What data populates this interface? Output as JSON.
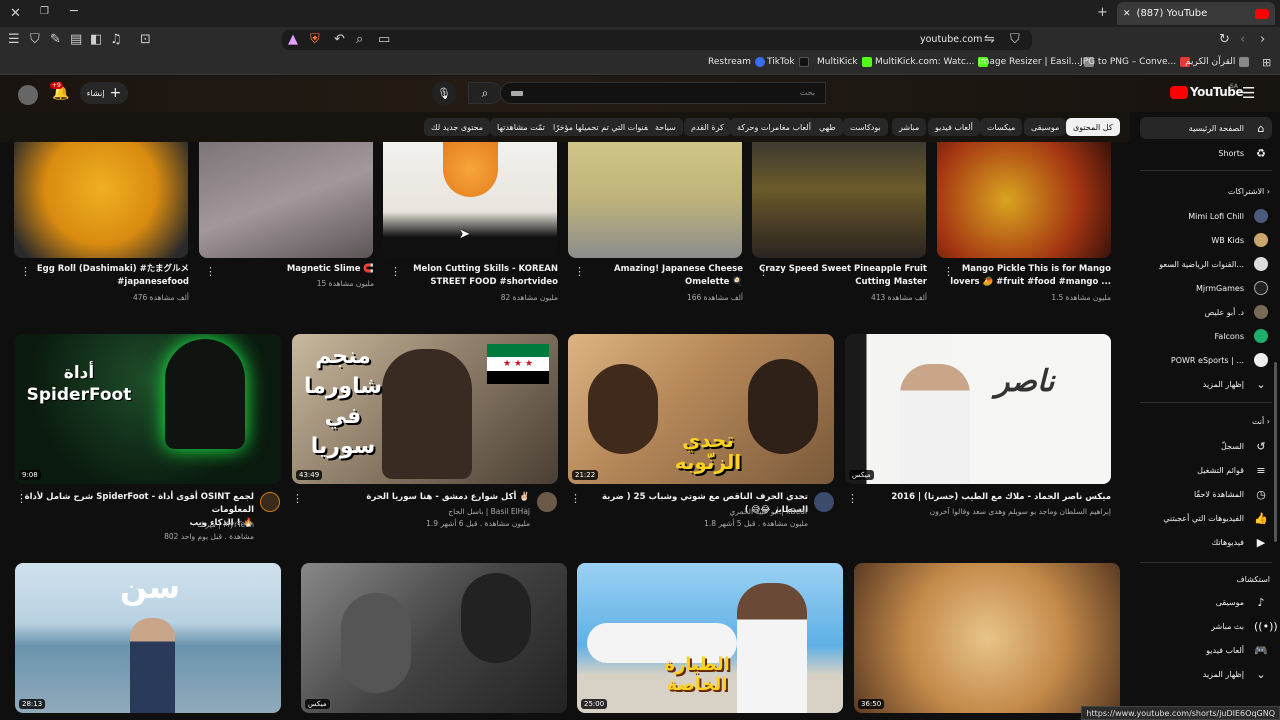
{
  "browser": {
    "tab_title": "(887) YouTube",
    "url": "youtube.com",
    "bookmarks": [
      "Restream",
      "TikTok",
      "MultiKick",
      "MultiKick.com: Watc...",
      "Image Resizer | Easil...",
      "JPG to PNG – Conve...",
      "القرآن الكريم"
    ],
    "status_url": "https://www.youtube.com/shorts/juDIE6OqGNQ"
  },
  "header": {
    "logo_text": "YouTube",
    "region": "SA",
    "search_placeholder": "بحث",
    "create_label": "إنشاء",
    "notif_count": "+9"
  },
  "chips": [
    "كل المحتوى",
    "موسيقى",
    "ميكسات",
    "ألعاب فيديو",
    "مباشر",
    "بودكاست",
    "طهي",
    "ألعاب مغامرات وحركة",
    "كرة القدم",
    "الفنوات التي تم تحميلها مؤخرًا",
    "سياحة",
    "تمّت مشاهدتها",
    "محتوى جديد لك"
  ],
  "sidebar": {
    "home": "الصفحة الرئيسية",
    "shorts": "Shorts",
    "subs_heading": "الاشتراكات",
    "subs": [
      "Mimi Lofi Chill",
      "WB Kids",
      "القنوات الرياضية السعو...",
      "MjrmGames",
      "د. أبو عليص",
      "Falcons",
      "POWR eSports | ...",
      "إظهار المزيد"
    ],
    "you_heading": "أنت",
    "you_items": [
      "السجلّ",
      "قوائم التشغيل",
      "المشاهدة لاحقًا",
      "الفيديوهات التي أعجبتني",
      "فيديوهاتك"
    ],
    "explore_heading": "استكشاف",
    "explore_items": [
      "موسيقى",
      "بث مباشر",
      "ألعاب فيديو",
      "إظهار المزيد"
    ]
  },
  "shorts": [
    {
      "title1": "Mango Pickle This is for Mango",
      "title2": "lovers 🥭 #fruit #food #mango ...",
      "views": "1.5 مليون مشاهدة"
    },
    {
      "title1": "Crazy Speed Sweet Pineapple Fruit",
      "title2": "Cutting Master",
      "views": "413 ألف مشاهدة"
    },
    {
      "title1": "Amazing! Japanese Cheese",
      "title2": "Omelette 🍳",
      "views": "166 ألف مشاهدة"
    },
    {
      "title1": "Melon Cutting Skills - KOREAN",
      "title2": "STREET FOOD #shortvideo",
      "views": "82 مليون مشاهدة"
    },
    {
      "title1": "Magnetic Slime 🧲",
      "title2": "",
      "views": "15 مليون مشاهدة"
    },
    {
      "title1": "Egg Roll (Dashimaki) #たまグルメ",
      "title2": "#japanesefood",
      "views": "476 ألف مشاهدة"
    }
  ],
  "videos": [
    {
      "title1": "ميكس ناصر الحماد - ملاك مع الطيب (حسرتا) | 2016",
      "title2": "",
      "meta1": "إبراهيم السلطان وماجد بو سويلم وهدى سعد وقالوا آخرون",
      "meta2": "",
      "duration": "ميكس",
      "thumb_text": "ناصر"
    },
    {
      "title1": "تحدي الحرف الناقص مع شوتي وشباب 25 ( ضربة السطاير 😂😅 )",
      "title2": "",
      "meta1": "أبو عبيد الحمري | xBear",
      "meta2": "1.8 مليون مشاهدة . قبل 5 أشهر",
      "duration": "21:22",
      "thumb_text": "تحدي الزنّوبه"
    },
    {
      "title1": "أكل شوارع دمشق - هنا سوريا الحرة ✌🏻",
      "title2": "",
      "meta1": "باسل الحاج | Basil ElHaj",
      "meta2": "1.9 مليون مشاهدة . قبل 6 أشهر",
      "duration": "43:49",
      "thumb_text": "منجم شاورما في سوريا"
    },
    {
      "title1": "شرح شامل لأداة SpiderFoot - أقوى أداة OSINT لجمع المعلومات",
      "title2": "الذكاء ويب ! 🔥",
      "meta1": "ميرتك | MyrTech",
      "meta2": "802 مشاهدة . قبل يوم واحد",
      "duration": "9:08",
      "thumb_text": "أداة SpiderFoot"
    }
  ],
  "row3": [
    {
      "duration": "36:50"
    },
    {
      "duration": "25:00",
      "thumb_text": "الطيارة الخاصة"
    },
    {
      "duration": "ميكس"
    },
    {
      "duration": "28:13",
      "thumb_text": "سن"
    }
  ],
  "colors": {
    "yt_red": "#ff0000",
    "bg": "#0f0f0f",
    "chip_active": "#f1f1f1"
  }
}
